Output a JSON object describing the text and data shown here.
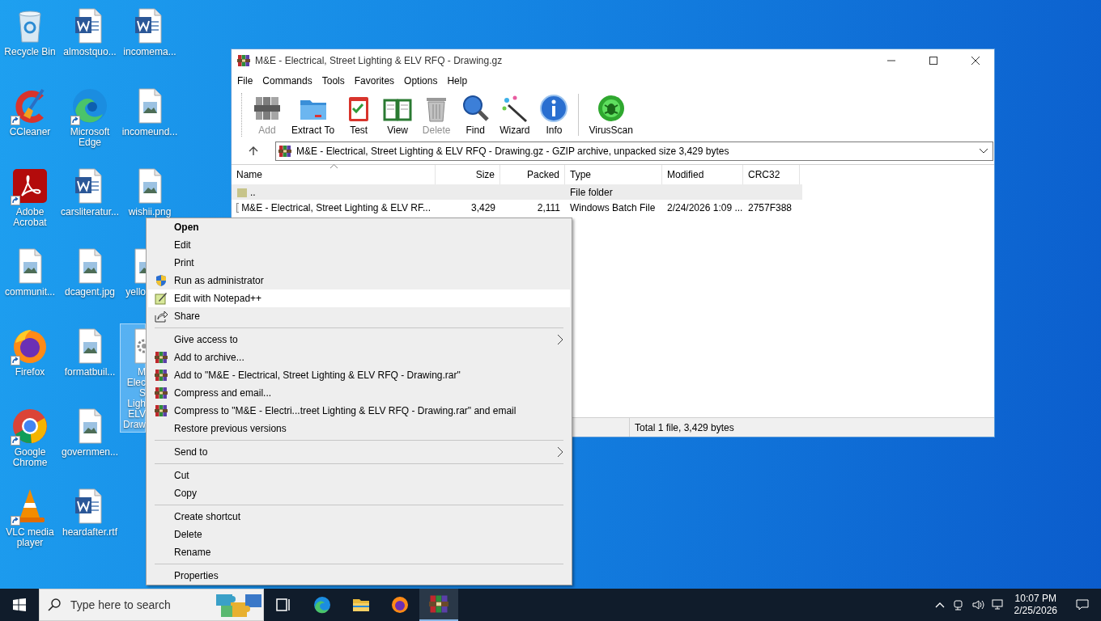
{
  "desktop": {
    "icons": [
      {
        "label": "Recycle Bin",
        "kind": "recycle",
        "shortcut": false,
        "selected": false
      },
      {
        "label": "CCleaner",
        "kind": "ccleaner",
        "shortcut": true,
        "selected": false
      },
      {
        "label": "Adobe Acrobat",
        "kind": "acrobat",
        "shortcut": true,
        "selected": false
      },
      {
        "label": "communit...",
        "kind": "image",
        "shortcut": false,
        "selected": false
      },
      {
        "label": "Firefox",
        "kind": "firefox",
        "shortcut": true,
        "selected": false
      },
      {
        "label": "Google Chrome",
        "kind": "chrome",
        "shortcut": true,
        "selected": false
      },
      {
        "label": "VLC media player",
        "kind": "vlc",
        "shortcut": true,
        "selected": false
      },
      {
        "label": "almostquo...",
        "kind": "word",
        "shortcut": false,
        "selected": false
      },
      {
        "label": "Microsoft Edge",
        "kind": "edge",
        "shortcut": true,
        "selected": false
      },
      {
        "label": "carsliteratur...",
        "kind": "word",
        "shortcut": false,
        "selected": false
      },
      {
        "label": "dcagent.jpg",
        "kind": "image",
        "shortcut": false,
        "selected": false
      },
      {
        "label": "formatbuil...",
        "kind": "image",
        "shortcut": false,
        "selected": false
      },
      {
        "label": "governmen...",
        "kind": "image",
        "shortcut": false,
        "selected": false
      },
      {
        "label": "heardafter.rtf",
        "kind": "word",
        "shortcut": false,
        "selected": false
      },
      {
        "label": "incomema...",
        "kind": "word",
        "shortcut": false,
        "selected": false
      },
      {
        "label": "incomeund...",
        "kind": "image",
        "shortcut": false,
        "selected": false
      },
      {
        "label": "wishii.png",
        "kind": "image",
        "shortcut": false,
        "selected": false
      },
      {
        "label": "yello",
        "kind": "image",
        "shortcut": false,
        "selected": false
      },
      {
        "label": "M Elec S Ligh ELV Draw",
        "kind": "batch",
        "shortcut": false,
        "selected": true
      }
    ]
  },
  "window": {
    "title": "M&E - Electrical, Street Lighting & ELV RFQ - Drawing.gz",
    "menu": [
      "File",
      "Commands",
      "Tools",
      "Favorites",
      "Options",
      "Help"
    ],
    "toolbar": [
      {
        "label": "Add",
        "kind": "add",
        "disabled": true
      },
      {
        "label": "Extract To",
        "kind": "extract",
        "disabled": false
      },
      {
        "label": "Test",
        "kind": "test",
        "disabled": false
      },
      {
        "label": "View",
        "kind": "view",
        "disabled": false
      },
      {
        "label": "Delete",
        "kind": "delete",
        "disabled": true
      },
      {
        "label": "Find",
        "kind": "find",
        "disabled": false
      },
      {
        "label": "Wizard",
        "kind": "wizard",
        "disabled": false
      },
      {
        "label": "Info",
        "kind": "info",
        "disabled": false
      },
      {
        "label": "VirusScan",
        "kind": "virus",
        "disabled": false
      }
    ],
    "address": "M&E - Electrical, Street Lighting & ELV RFQ - Drawing.gz - GZIP archive, unpacked size 3,429 bytes",
    "columns": [
      {
        "label": "Name",
        "sorted": true
      },
      {
        "label": "Size",
        "sorted": false
      },
      {
        "label": "Packed",
        "sorted": false
      },
      {
        "label": "Type",
        "sorted": false
      },
      {
        "label": "Modified",
        "sorted": false
      },
      {
        "label": "CRC32",
        "sorted": false
      }
    ],
    "rows": [
      {
        "kind": "folder",
        "selected": true,
        "name": "..",
        "type": "File folder"
      },
      {
        "kind": "batch",
        "selected": false,
        "name": "M&E - Electrical, Street Lighting & ELV RF...",
        "size": "3,429",
        "packed": "2,111",
        "type": "Windows Batch File",
        "modified": "2/24/2026 1:09 ...",
        "crc32": "2757F388"
      }
    ],
    "status": "Total 1 file, 3,429 bytes"
  },
  "context_menu": {
    "groups": [
      [
        {
          "label": "Open",
          "kind": "plain",
          "bold": true,
          "highlighted": false,
          "submenu": false
        },
        {
          "label": "Edit",
          "kind": "plain",
          "bold": false,
          "highlighted": false,
          "submenu": false
        },
        {
          "label": "Print",
          "kind": "plain",
          "bold": false,
          "highlighted": false,
          "submenu": false
        },
        {
          "label": "Run as administrator",
          "kind": "admin",
          "bold": false,
          "highlighted": false,
          "submenu": false
        },
        {
          "label": "Edit with Notepad++",
          "kind": "notepad",
          "bold": false,
          "highlighted": true,
          "submenu": false
        },
        {
          "label": "Share",
          "kind": "share",
          "bold": false,
          "highlighted": false,
          "submenu": false
        }
      ],
      [
        {
          "label": "Give access to",
          "kind": "plain",
          "bold": false,
          "highlighted": false,
          "submenu": true
        },
        {
          "label": "Add to archive...",
          "kind": "archive",
          "bold": false,
          "highlighted": false,
          "submenu": false
        },
        {
          "label": "Add to \"M&E - Electrical, Street Lighting & ELV RFQ - Drawing.rar\"",
          "kind": "archive",
          "bold": false,
          "highlighted": false,
          "submenu": false
        },
        {
          "label": "Compress and email...",
          "kind": "archive",
          "bold": false,
          "highlighted": false,
          "submenu": false
        },
        {
          "label": "Compress to \"M&E - Electri...treet Lighting & ELV RFQ - Drawing.rar\" and email",
          "kind": "archive",
          "bold": false,
          "highlighted": false,
          "submenu": false
        },
        {
          "label": "Restore previous versions",
          "kind": "plain",
          "bold": false,
          "highlighted": false,
          "submenu": false
        }
      ],
      [
        {
          "label": "Send to",
          "kind": "plain",
          "bold": false,
          "highlighted": false,
          "submenu": true
        }
      ],
      [
        {
          "label": "Cut",
          "kind": "plain",
          "bold": false,
          "highlighted": false,
          "submenu": false
        },
        {
          "label": "Copy",
          "kind": "plain",
          "bold": false,
          "highlighted": false,
          "submenu": false
        }
      ],
      [
        {
          "label": "Create shortcut",
          "kind": "plain",
          "bold": false,
          "highlighted": false,
          "submenu": false
        },
        {
          "label": "Delete",
          "kind": "plain",
          "bold": false,
          "highlighted": false,
          "submenu": false
        },
        {
          "label": "Rename",
          "kind": "plain",
          "bold": false,
          "highlighted": false,
          "submenu": false
        }
      ],
      [
        {
          "label": "Properties",
          "kind": "plain",
          "bold": false,
          "highlighted": false,
          "submenu": false
        }
      ]
    ]
  },
  "taskbar": {
    "search_placeholder": "Type here to search",
    "apps": [
      {
        "kind": "taskview",
        "active": false
      },
      {
        "kind": "edge",
        "active": false
      },
      {
        "kind": "explorer",
        "active": false
      },
      {
        "kind": "firefox",
        "active": false
      },
      {
        "kind": "books",
        "active": true
      }
    ],
    "time": "10:07 PM",
    "date": "2/25/2026"
  }
}
